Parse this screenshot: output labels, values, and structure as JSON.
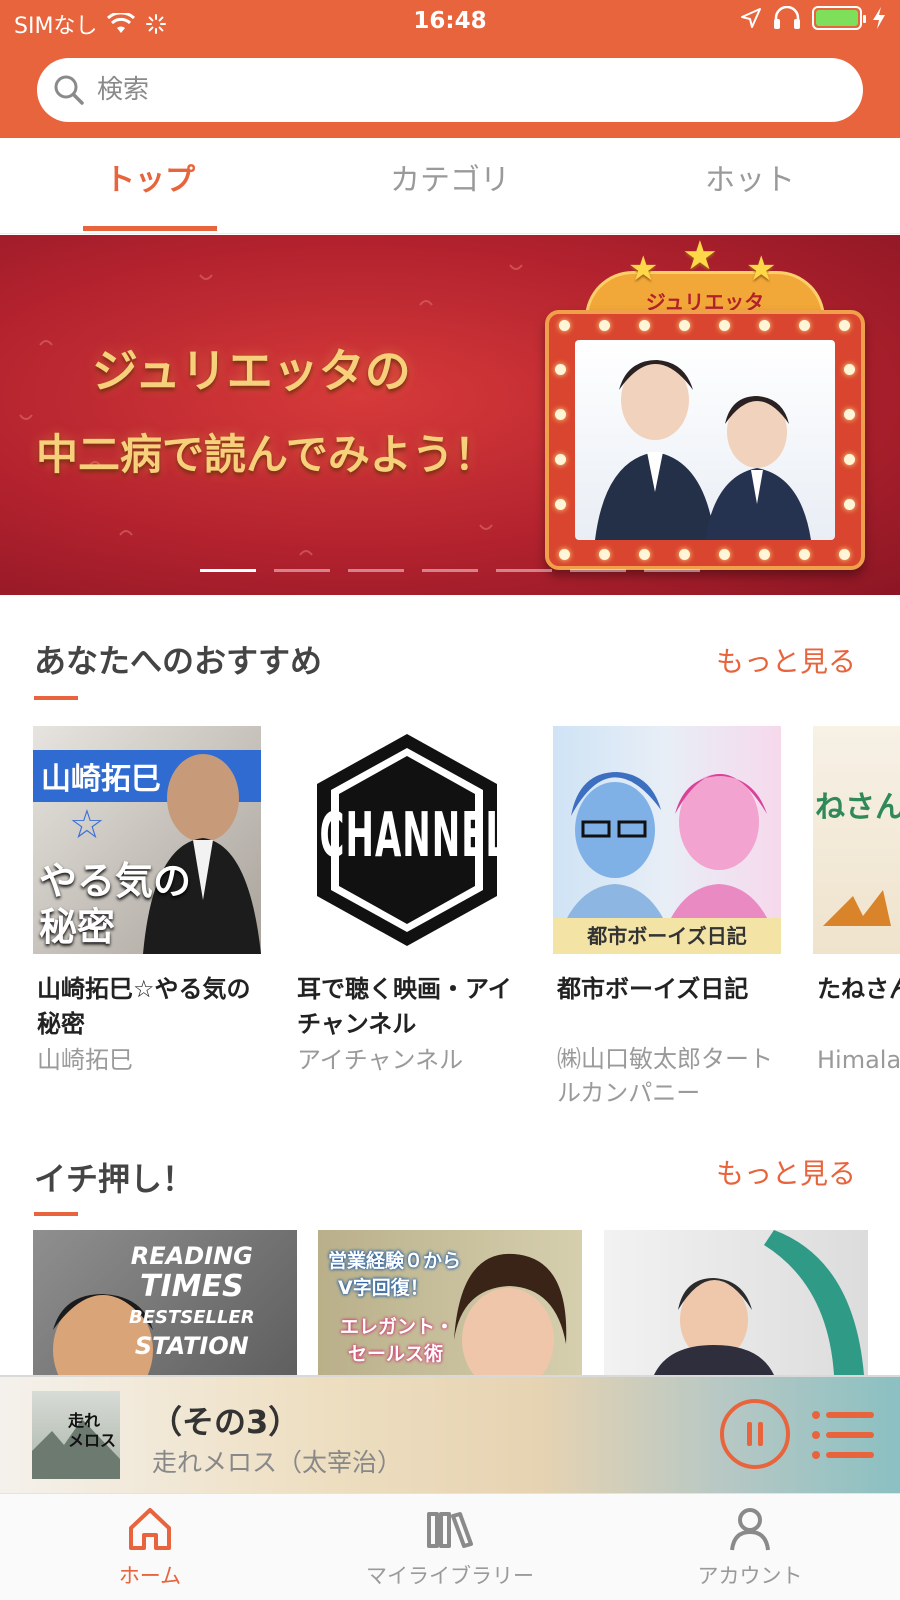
{
  "status_bar": {
    "carrier": "SIMなし",
    "time": "16:48"
  },
  "search": {
    "placeholder": "検索"
  },
  "tabs": [
    {
      "label": "トップ",
      "active": true
    },
    {
      "label": "カテゴリ",
      "active": false
    },
    {
      "label": "ホット",
      "active": false
    }
  ],
  "banner": {
    "line1": "ジュリエッタの",
    "line2": "中二病で読んでみよう！",
    "marquee": "ジュリエッタ",
    "slide_count": 7,
    "active_slide": 1
  },
  "recommend": {
    "title": "あなたへのおすすめ",
    "more": "もっと見る",
    "items": [
      {
        "title": "山崎拓巳☆やる気の秘密",
        "author": "山崎拓巳",
        "cover_text": [
          "山崎拓巳",
          "☆",
          "やる気の",
          "秘密"
        ]
      },
      {
        "title": "耳で聴く映画・アイチャンネル",
        "author": "アイチャンネル",
        "cover_text": "ICHANNEL"
      },
      {
        "title": "都市ボーイズ日記",
        "author": "㈱山口敏太郎タートルカンパニー",
        "cover_text": "都市ボーイズ日記"
      },
      {
        "title": "たねさん",
        "author": "Himala",
        "cover_text": "ねさん"
      }
    ]
  },
  "picks": {
    "title": "イチ押し！",
    "more": "もっと見る",
    "items": [
      {
        "cover_text": [
          "READING",
          "TIMES",
          "BESTSELLER",
          "STATION"
        ]
      },
      {
        "cover_text": [
          "営業経験０から",
          "V字回復！",
          "エレガント・",
          "セールス術"
        ]
      },
      {
        "cover_text": []
      }
    ]
  },
  "player": {
    "title": "（その3）",
    "subtitle": "走れメロス（太宰治）",
    "cover_text": [
      "走れ",
      "メロス"
    ]
  },
  "bottom_nav": [
    {
      "label": "ホーム",
      "icon": "home-icon",
      "active": true
    },
    {
      "label": "マイライブラリー",
      "icon": "library-icon",
      "active": false
    },
    {
      "label": "アカウント",
      "icon": "account-icon",
      "active": false
    }
  ],
  "colors": {
    "accent": "#e8643c"
  }
}
